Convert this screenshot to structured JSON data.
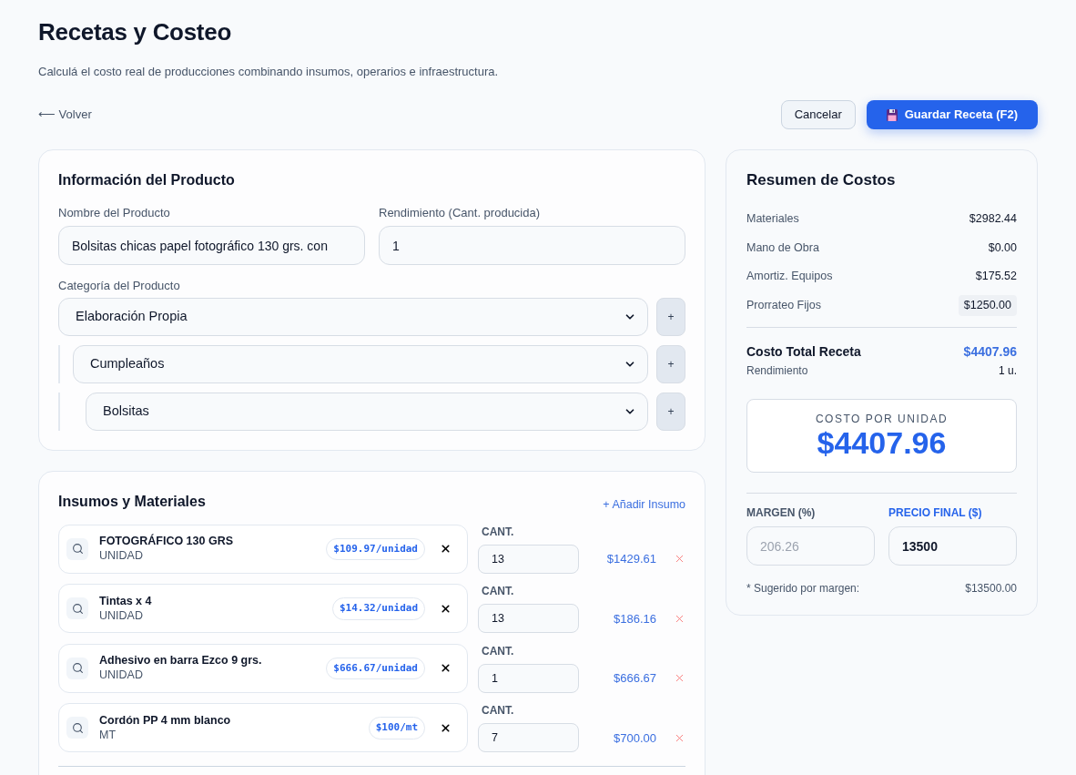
{
  "page": {
    "title": "Recetas y Costeo",
    "subtitle": "Calculá el costo real de producciones combinando insumos, operarios e infraestructura."
  },
  "toolbar": {
    "back_link": "⟵ Volver",
    "buttons": [
      {
        "label": "Cancelar",
        "kind": "secondary"
      },
      {
        "label": "Guardar Receta (F2)",
        "kind": "primary"
      }
    ]
  },
  "product_info": {
    "title": "Información del Producto",
    "fields": [
      {
        "label": "Nombre del Producto",
        "value": "Bolsitas chicas papel fotográfico 130 grs. con"
      },
      {
        "label": "Rendimiento (Cant. producida)",
        "value": "1"
      }
    ],
    "category": {
      "label": "Categoría del Producto",
      "tree": [
        {
          "value": "Elaboración Propia",
          "add_button": "+",
          "children": [
            {
              "value": "Cumpleaños",
              "add_button": "+",
              "children": [
                {
                  "value": "Bolsitas",
                  "add_button": "+"
                }
              ]
            }
          ]
        }
      ]
    }
  },
  "materials": {
    "title": "Insumos y Materiales",
    "add_link": "+ Añadir Insumo",
    "rows": [
      {
        "name": "FOTOGRÁFICO 130 GRS",
        "unit": "UNIDAD",
        "unit_price": "$109.97/unidad",
        "quantity_label": "CANT.",
        "quantity": "13",
        "total": "$1429.61"
      },
      {
        "name": "Tintas x 4",
        "unit": "UNIDAD",
        "unit_price": "$14.32/unidad",
        "quantity_label": "CANT.",
        "quantity": "13",
        "total": "$186.16"
      },
      {
        "name": "Adhesivo en barra Ezco 9 grs.",
        "unit": "UNIDAD",
        "unit_price": "$666.67/unidad",
        "quantity_label": "CANT.",
        "quantity": "1",
        "total": "$666.67"
      },
      {
        "name": "Cordón PP 4 mm blanco",
        "unit": "MT",
        "unit_price": "$100/mt",
        "quantity_label": "CANT.",
        "quantity": "7",
        "total": "$700.00"
      }
    ]
  },
  "summary": {
    "title": "Resumen de Costos",
    "lines": [
      {
        "label": "Materiales",
        "value": "$2982.44",
        "highlighted": false
      },
      {
        "label": "Mano de Obra",
        "value": "$0.00",
        "highlighted": false
      },
      {
        "label": "Amortiz. Equipos",
        "value": "$175.52",
        "highlighted": false
      },
      {
        "label": "Prorrateo Fijos",
        "value": "$1250.00",
        "highlighted": true
      }
    ],
    "total": {
      "label": "Costo Total Receta",
      "value": "$4407.96"
    },
    "yield": {
      "label": "Rendimiento",
      "value": "1 u."
    },
    "unit_cost": {
      "label": "COSTO POR UNIDAD",
      "value": "$4407.96"
    },
    "pricing": [
      {
        "label": "MARGEN (%)",
        "placeholder": "206.26",
        "active": false
      },
      {
        "label": "PRECIO FINAL ($)",
        "value": "13500",
        "active": true
      }
    ],
    "suggested": {
      "label": "* Sugerido por margen:",
      "value": "$13500.00"
    }
  }
}
